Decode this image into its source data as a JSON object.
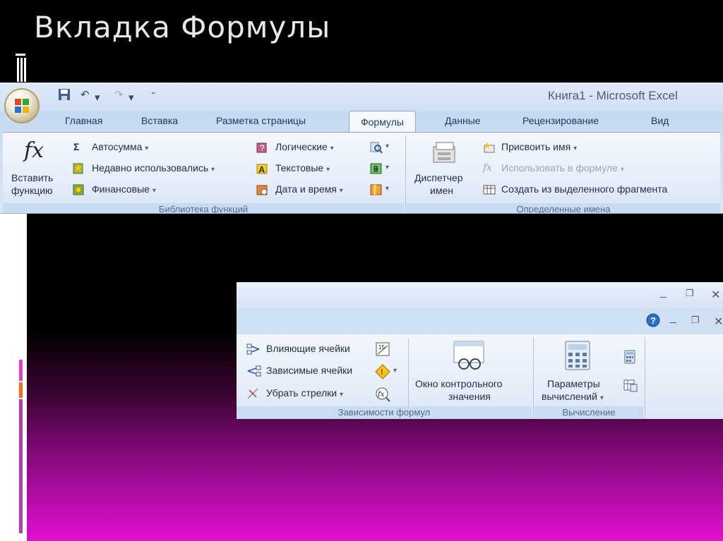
{
  "slide": {
    "title": "Вкладка Формулы"
  },
  "ribbon1": {
    "window_title": "Книга1 - Microsoft Excel",
    "tabs": [
      "Главная",
      "Вставка",
      "Разметка страницы",
      "Формулы",
      "Данные",
      "Рецензирование",
      "Вид"
    ],
    "active_tab": "Формулы",
    "function_library": {
      "insert_function_line1": "Вставить",
      "insert_function_line2": "функцию",
      "fx_glyph": "fx",
      "autosum": "Автосумма",
      "recently_used": "Недавно использовались",
      "financial": "Финансовые",
      "logical": "Логические",
      "text": "Текстовые",
      "date_time": "Дата и время",
      "group_label": "Библиотека функций"
    },
    "defined_names": {
      "name_manager_line1": "Диспетчер",
      "name_manager_line2": "имен",
      "define_name": "Присвоить имя",
      "use_in_formula": "Использовать в формуле",
      "create_from_selection": "Создать из выделенного фрагмента",
      "group_label": "Определенные имена"
    }
  },
  "ribbon2": {
    "formula_auditing": {
      "trace_precedents": "Влияющие ячейки",
      "trace_dependents": "Зависимые ячейки",
      "remove_arrows": "Убрать стрелки",
      "watch_window_line1": "Окно контрольного",
      "watch_window_line2": "значения",
      "group_label": "Зависимости формул"
    },
    "calculation": {
      "calc_options_line1": "Параметры",
      "calc_options_line2": "вычислений",
      "group_label": "Вычисление"
    }
  },
  "colors": {
    "accent": "#1e3a63",
    "ribbon_bg": "#dfeaf7",
    "slide_gradient_end": "#e010d0"
  },
  "icons": [
    "office-button-icon",
    "save-icon",
    "undo-icon",
    "redo-icon",
    "customize-qat-icon",
    "sigma-icon",
    "help-icon",
    "minimize-icon",
    "restore-icon",
    "close-icon"
  ]
}
